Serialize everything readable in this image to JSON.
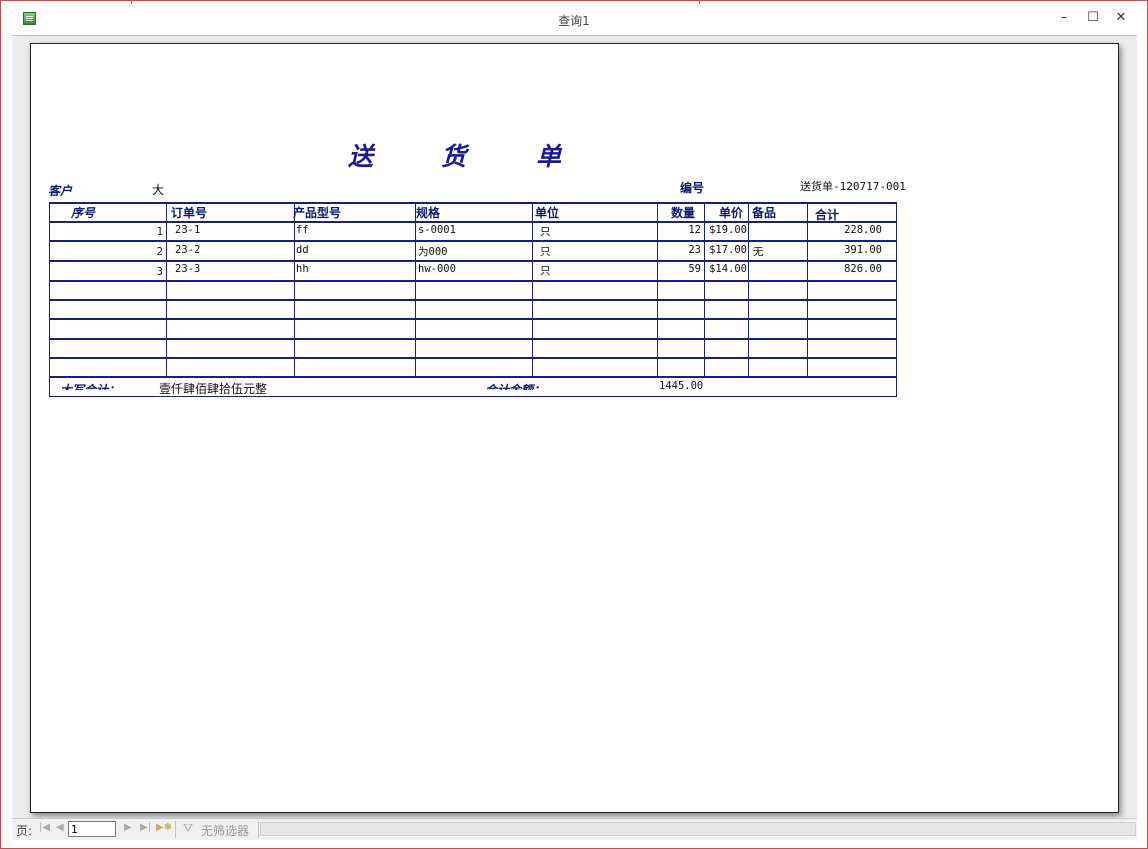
{
  "window": {
    "title": "查询1",
    "minimize_glyph": "–",
    "maximize_glyph": "☐",
    "close_glyph": "✕"
  },
  "report": {
    "title_chars": [
      "送",
      "货",
      "单"
    ],
    "customer_label": "客户",
    "customer_value": "大",
    "number_label": "编号",
    "number_value": "送货单-120717-001",
    "columns": [
      "序号",
      "订单号",
      "产品型号",
      "规格",
      "单位",
      "数量",
      "单价",
      "备品",
      "合计"
    ],
    "rows": [
      {
        "seq": "1",
        "order": "23-1",
        "model": "ff",
        "spec": "s-0001",
        "unit": "只",
        "qty": "12",
        "price": "$19.00",
        "spare": "",
        "total": "228.00"
      },
      {
        "seq": "2",
        "order": "23-2",
        "model": "dd",
        "spec": "为000",
        "unit": "只",
        "qty": "23",
        "price": "$17.00",
        "spare": "无",
        "total": "391.00"
      },
      {
        "seq": "3",
        "order": "23-3",
        "model": "hh",
        "spec": "hw-000",
        "unit": "只",
        "qty": "59",
        "price": "$14.00",
        "spare": "",
        "total": "826.00"
      }
    ],
    "empty_rows": 5,
    "uppercase_total_label": "大写合计：",
    "uppercase_total_value": "壹仟肆佰肆拾伍元整",
    "total_amount_label": "合计金额：",
    "total_amount_value": "1445.00"
  },
  "statusbar": {
    "page_label": "页:",
    "page_value": "1",
    "filter_label": "无筛选器",
    "icons": [
      "first-page-icon",
      "prev-page-icon",
      "next-page-icon",
      "last-page-icon",
      "new-page-icon",
      "filter-icon"
    ]
  },
  "colors": {
    "accent": "#1b1f7a",
    "title": "#1a1a8c",
    "window_border": "#c0504d"
  }
}
